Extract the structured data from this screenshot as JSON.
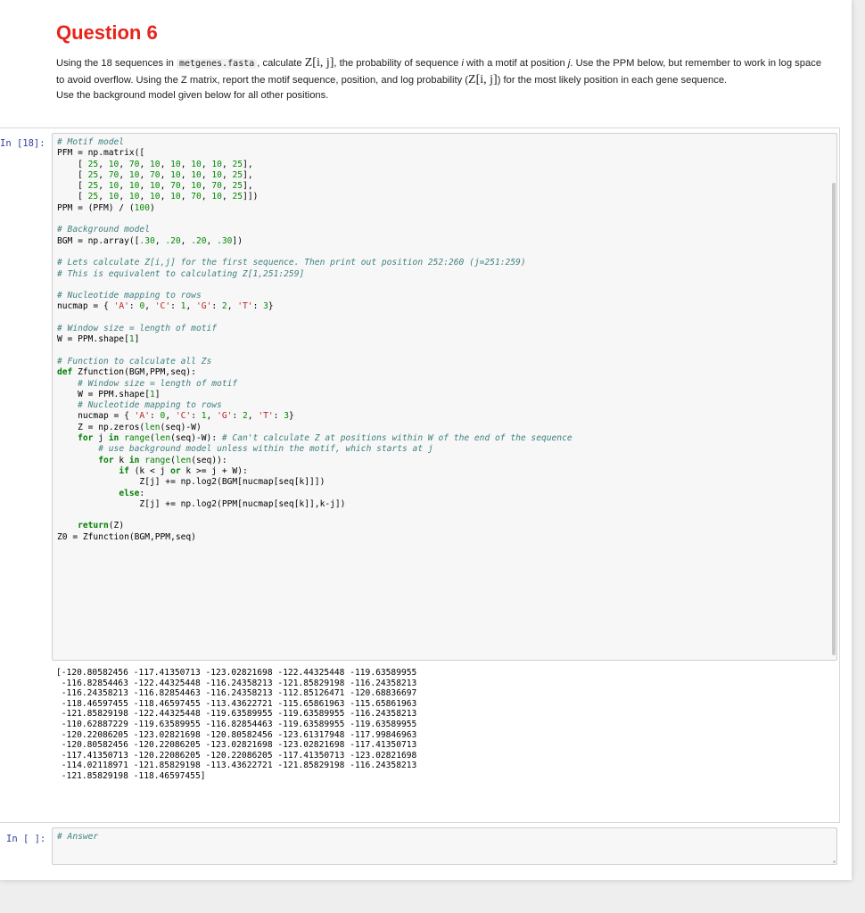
{
  "question": {
    "title": "Question 6",
    "p1_a": "Using the 18 sequences in ",
    "p1_code": "metgenes.fasta",
    "p1_b": ", calculate ",
    "p1_c": ", the probability of sequence ",
    "p1_i": "i",
    "p1_d": " with a motif at position ",
    "p1_j": "j",
    "p1_e": ". Use the PPM below, but remember to work in log space to avoid overflow. Using the Z matrix, report the motif sequence, position, and log probability (",
    "p1_f": ") for the most likely position in each gene sequence.",
    "z_symbol": "Z[i, j]",
    "p2": "Use the background model given below for all other positions."
  },
  "cell1": {
    "prompt": "In [18]:",
    "code_lines": [
      "# Motif model",
      "PFM = np.matrix([",
      "    [ 25, 10, 70, 10, 10, 10, 10, 25],",
      "    [ 25, 70, 10, 70, 10, 10, 10, 25],",
      "    [ 25, 10, 10, 10, 70, 10, 70, 25],",
      "    [ 25, 10, 10, 10, 10, 70, 10, 25]])",
      "PPM = (PFM) / (100)",
      "",
      "# Background model",
      "BGM = np.array([.30, .20, .20, .30])",
      "",
      "# Lets calculate Z[i,j] for the first sequence. Then print out position 252:260 (j=251:259)",
      "# This is equivalent to calculating Z[1,251:259]",
      "",
      "# Nucleotide mapping to rows",
      "nucmap = { 'A': 0, 'C': 1, 'G': 2, 'T': 3}",
      "",
      "# Window size = length of motif",
      "W = PPM.shape[1]",
      "",
      "# Function to calculate all Zs",
      "def Zfunction(BGM,PPM,seq):",
      "    # Window size = length of motif",
      "    W = PPM.shape[1]",
      "    # Nucleotide mapping to rows",
      "    nucmap = { 'A': 0, 'C': 1, 'G': 2, 'T': 3}",
      "    Z = np.zeros(len(seq)-W)",
      "    for j in range(len(seq)-W): # Can't calculate Z at positions within W of the end of the sequence",
      "        # use background model unless within the motif, which starts at j",
      "        for k in range(len(seq)):",
      "            if (k < j or k >= j + W):",
      "                Z[j] += np.log2(BGM[nucmap[seq[k]]])",
      "            else:",
      "                Z[j] += np.log2(PPM[nucmap[seq[k]],k-j])",
      "",
      "    return(Z)",
      "Z0 = Zfunction(BGM,PPM,seq)"
    ],
    "output_lines": [
      "[-120.80582456 -117.41350713 -123.02821698 -122.44325448 -119.63589955",
      " -116.82854463 -122.44325448 -116.24358213 -121.85829198 -116.24358213",
      " -116.24358213 -116.82854463 -116.24358213 -112.85126471 -120.68836697",
      " -118.46597455 -118.46597455 -113.43622721 -115.65861963 -115.65861963",
      " -121.85829198 -122.44325448 -119.63589955 -119.63589955 -116.24358213",
      " -110.62887229 -119.63589955 -116.82854463 -119.63589955 -119.63589955",
      " -120.22086205 -123.02821698 -120.80582456 -123.61317948 -117.99846963",
      " -120.80582456 -120.22086205 -123.02821698 -123.02821698 -117.41350713",
      " -117.41350713 -120.22086205 -120.22086205 -117.41350713 -123.02821698",
      " -114.02118971 -121.85829198 -113.43622721 -121.85829198 -116.24358213",
      " -121.85829198 -118.46597455]"
    ]
  },
  "cell2": {
    "prompt": "In [ ]:",
    "code": "# Answer"
  },
  "colors": {
    "title": "#e8231a",
    "prompt": "#303f9f",
    "comment": "#408080",
    "keyword": "#008000",
    "string": "#ba2121"
  }
}
